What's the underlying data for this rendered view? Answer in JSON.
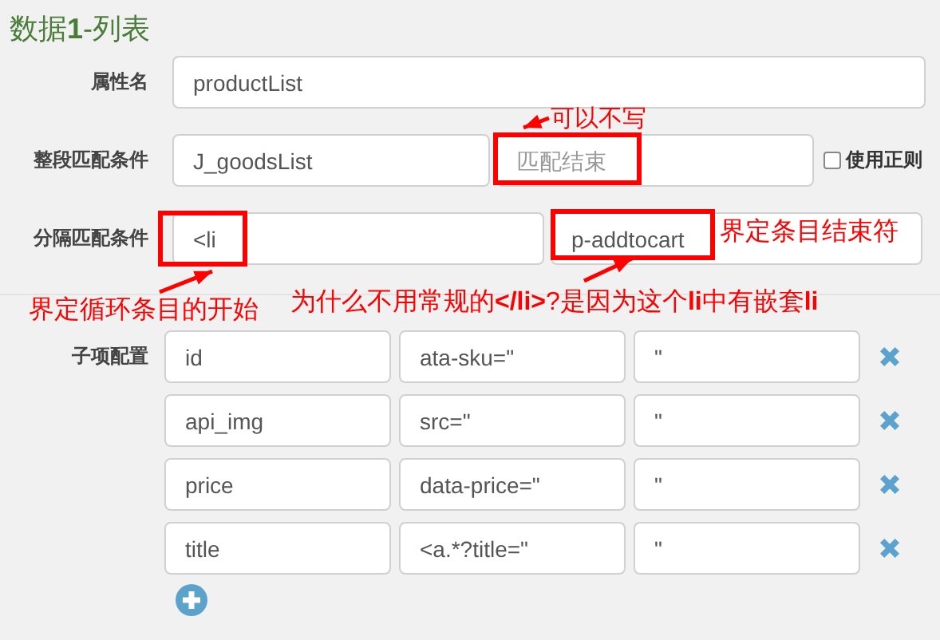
{
  "section_title": "数据**1**-列表",
  "rows": [
    {
      "label": "属性名",
      "fields": [
        {
          "value": "productList",
          "highlighted": false
        }
      ]
    },
    {
      "label": "整段匹配条件",
      "fields": [
        {
          "value": "J_goodsList",
          "highlighted": false
        },
        {
          "placeholder": "匹配结束",
          "highlighted": true
        }
      ],
      "checkbox": {
        "label": "使用正则",
        "checked": false
      }
    },
    {
      "label": "分隔匹配条件",
      "fields": [
        {
          "value": "<li",
          "highlighted": true
        },
        {
          "value": "p-addtocart",
          "highlighted": true
        }
      ]
    }
  ],
  "annotations": [
    {
      "text": "可以不写"
    },
    {
      "text": "界定条目结束符"
    },
    {
      "text": "界定循环条目的开始"
    },
    {
      "text": "为什么不用常规的**</li>**?是因为这个**li**中有嵌套**li**"
    }
  ],
  "sub_items": {
    "label": "子项配置",
    "rows": [
      {
        "name": "id",
        "start": "ata-sku=\"",
        "end": "\""
      },
      {
        "name": "api_img",
        "start": "src=\"",
        "end": "\""
      },
      {
        "name": "price",
        "start": "data-price=\"",
        "end": "\""
      },
      {
        "name": "title",
        "start": "<a.*?title=\"",
        "end": "\""
      }
    ]
  }
}
